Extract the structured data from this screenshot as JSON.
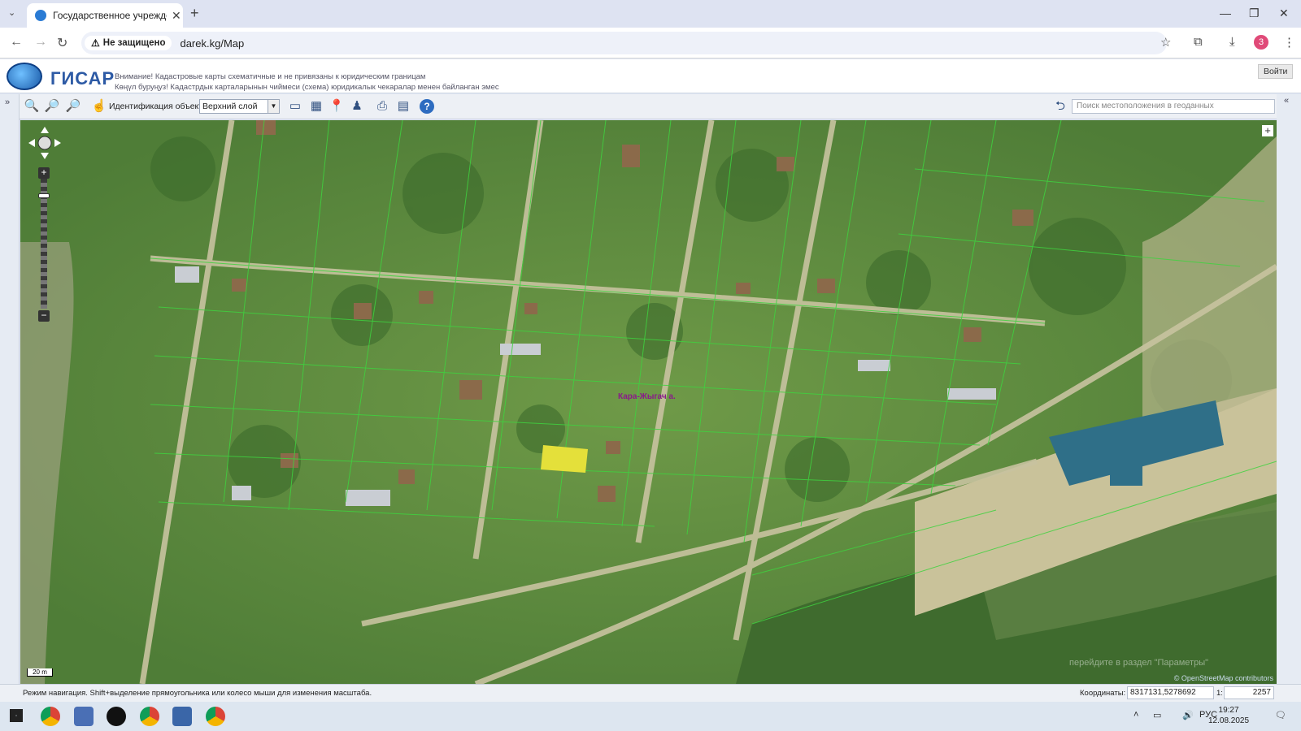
{
  "browser": {
    "tab_title": "Государственное учреждение",
    "new_tab_label": "+",
    "security_label": "Не защищено",
    "url": "darek.kg/Map",
    "profile_initial": "3"
  },
  "header": {
    "logo_text": "ГИСАР",
    "notice_ru": "Внимание! Кадастровые карты схематичные и не привязаны к юридическим границам",
    "notice_kg": "Көңүл буруңуз! Кадастрдык карталарынын чиймеси (схема) юридикалык чекаралар менен байланган эмес",
    "login_label": "Войти"
  },
  "toolbar": {
    "identify_label": "Идентификация объекта:",
    "layer_selected": "Верхний слой",
    "geo_search_placeholder": "Поиск местоположения в геоданных"
  },
  "map": {
    "place_label": "Кара-Жыгач а.",
    "scale_bar": "20 m",
    "attribution": "© OpenStreetMap contributors",
    "watermark": "перейдите в раздел \"Параметры\""
  },
  "status": {
    "mode_text": "Режим навигация. Shift+выделение прямоугольника или колесо мыши для изменения масштаба.",
    "coords_label": "Координаты:",
    "coords_value": "8317131,5278692",
    "scale_label": "1:",
    "scale_value": "2257"
  },
  "taskbar": {
    "lang": "РУС",
    "time": "19:27",
    "date": "12.08.2025"
  },
  "colors": {
    "selected_parcel": "#e4e03a",
    "parcel_lines": "#38c238",
    "accent": "#2d5aa5"
  }
}
